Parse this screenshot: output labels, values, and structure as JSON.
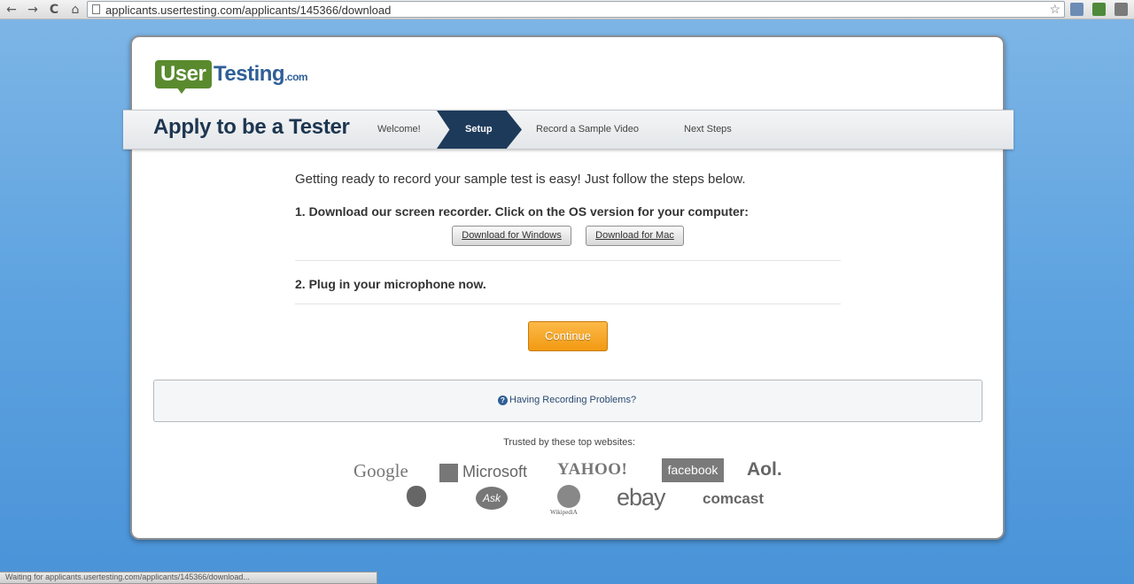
{
  "browser": {
    "url": "applicants.usertesting.com/applicants/145366/download",
    "back_glyph": "←",
    "forward_glyph": "→",
    "reload_glyph": "C",
    "home_glyph": "⌂",
    "star_glyph": "☆"
  },
  "logo": {
    "user": "User",
    "testing": "Testing",
    "dotcom": ".com"
  },
  "banner": {
    "title": "Apply to be a Tester",
    "steps": [
      "Welcome!",
      "Setup",
      "Record a Sample Video",
      "Next Steps"
    ],
    "active_step": "Setup"
  },
  "content": {
    "intro": "Getting ready to record your sample test is easy! Just follow the steps below.",
    "step1": "1. Download our screen recorder. Click on the OS version for your computer:",
    "download_windows": "Download for Windows",
    "download_mac": "Download for Mac",
    "step2": "2. Plug in your microphone now.",
    "continue": "Continue",
    "help_glyph": "?",
    "problems": "Having Recording Problems?",
    "trusted": "Trusted by these top websites:"
  },
  "brands": {
    "google": "Google",
    "microsoft": "Microsoft",
    "yahoo": "YAHOO!",
    "facebook": "facebook",
    "aol": "Aol.",
    "ask": "Ask",
    "wikipedia": "WikipediA",
    "ebay": "ebay",
    "comcast": "comcast"
  },
  "colors": {
    "background": "#5ea3e0",
    "banner_active": "#1e3a5a",
    "continue": "#f29a12",
    "logo_green": "#5a8a2e",
    "logo_blue": "#2f5f96"
  },
  "status_bar": {
    "text": "Waiting for applicants.usertesting.com/applicants/145366/download..."
  }
}
